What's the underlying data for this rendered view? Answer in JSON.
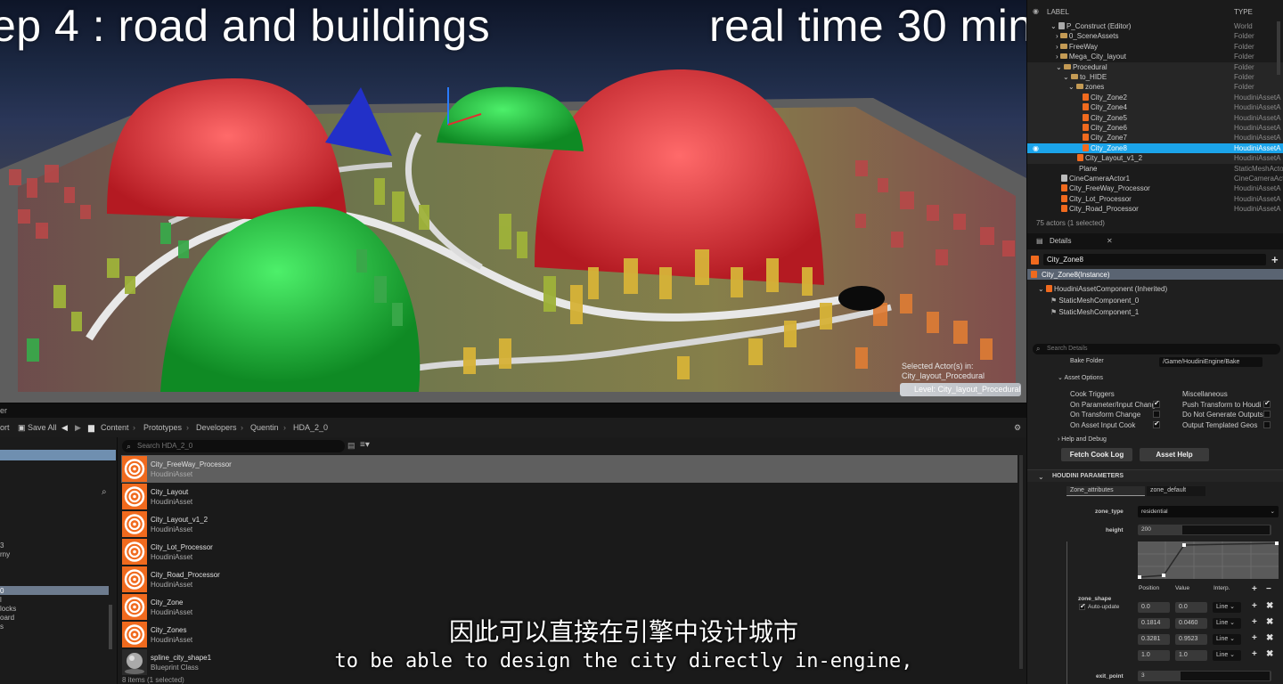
{
  "overlay": {
    "step_title": "ep 4 : road and buildings",
    "time_label": "real time 30 min"
  },
  "viewport": {
    "selected_actor_label": "Selected Actor(s) in:",
    "selected_level": "City_layout_Procedural",
    "level_pill": "Level: City_layout_Procedural"
  },
  "content_browser": {
    "tab_label": "er",
    "toolbar": {
      "import_label": "ort",
      "save_all": "Save All",
      "breadcrumbs": [
        "Content",
        "Prototypes",
        "Developers",
        "Quentin",
        "HDA_2_0"
      ]
    },
    "search_placeholder": "Search HDA_2_0",
    "left_folders": [
      "3",
      "rny",
      "0",
      "l",
      "locks",
      "oard",
      "s"
    ],
    "assets": [
      {
        "name": "City_FreeWay_Processor",
        "type": "HoudiniAsset"
      },
      {
        "name": "City_Layout",
        "type": "HoudiniAsset"
      },
      {
        "name": "City_Layout_v1_2",
        "type": "HoudiniAsset"
      },
      {
        "name": "City_Lot_Processor",
        "type": "HoudiniAsset"
      },
      {
        "name": "City_Road_Processor",
        "type": "HoudiniAsset"
      },
      {
        "name": "City_Zone",
        "type": "HoudiniAsset"
      },
      {
        "name": "City_Zones",
        "type": "HoudiniAsset"
      },
      {
        "name": "spline_city_shape1",
        "type": "Blueprint Class"
      }
    ],
    "status": "8 items (1 selected)"
  },
  "subtitles": {
    "chinese": "因此可以直接在引擎中设计城市",
    "english": "to be able to design the city directly in-engine,"
  },
  "outliner": {
    "col_label": "LABEL",
    "col_type": "TYPE",
    "rows": [
      {
        "label": "P_Construct (Editor)",
        "type": "World"
      },
      {
        "label": "0_SceneAssets",
        "type": "Folder"
      },
      {
        "label": "FreeWay",
        "type": "Folder"
      },
      {
        "label": "Mega_City_layout",
        "type": "Folder"
      },
      {
        "label": "Procedural",
        "type": "Folder"
      },
      {
        "label": "to_HIDE",
        "type": "Folder"
      },
      {
        "label": "zones",
        "type": "Folder"
      },
      {
        "label": "City_Zone2",
        "type": "HoudiniAssetA"
      },
      {
        "label": "City_Zone4",
        "type": "HoudiniAssetA"
      },
      {
        "label": "City_Zone5",
        "type": "HoudiniAssetA"
      },
      {
        "label": "City_Zone6",
        "type": "HoudiniAssetA"
      },
      {
        "label": "City_Zone7",
        "type": "HoudiniAssetA"
      },
      {
        "label": "City_Zone8",
        "type": "HoudiniAssetA"
      },
      {
        "label": "City_Layout_v1_2",
        "type": "HoudiniAssetA"
      },
      {
        "label": "Plane",
        "type": "StaticMeshActo"
      },
      {
        "label": "CineCameraActor1",
        "type": "CineCameraActo"
      },
      {
        "label": "City_FreeWay_Processor",
        "type": "HoudiniAssetA"
      },
      {
        "label": "City_Lot_Processor",
        "type": "HoudiniAssetA"
      },
      {
        "label": "City_Road_Processor",
        "type": "HoudiniAssetA"
      }
    ],
    "count": "75 actors (1 selected)"
  },
  "details": {
    "tab": "Details",
    "actor_name": "City_Zone8",
    "instance": "City_Zone8(Instance)",
    "components": [
      "HoudiniAssetComponent (Inherited)",
      "StaticMeshComponent_0",
      "StaticMeshComponent_1"
    ],
    "search_placeholder": "Search Details",
    "bake_folder_label": "Bake Folder",
    "bake_folder_value": "/Game/HoudiniEngine/Bake",
    "asset_options": "Asset Options",
    "cook_triggers": "Cook Triggers",
    "miscellaneous": "Miscellaneous",
    "opt_param_input": "On Parameter/Input Chang",
    "opt_transform": "On Transform Change",
    "opt_asset_input": "On Asset Input Cook",
    "opt_push_transform": "Push Transform to Houdi",
    "opt_no_gen_outputs": "Do Not Generate Outputs",
    "opt_templated": "Output Templated Geos",
    "help_debug": "Help and Debug",
    "fetch_cook_log": "Fetch Cook Log",
    "asset_help": "Asset Help",
    "houdini_params": "HOUDINI PARAMETERS",
    "tab_zone_attributes": "Zone_attributes",
    "tab_zone_default": "zone_default",
    "zone_type_label": "zone_type",
    "zone_type_value": "residential",
    "height_label": "height",
    "height_value": "200",
    "zone_shape_label": "zone_shape",
    "auto_update": "Auto-update",
    "ramp_col_position": "Position",
    "ramp_col_value": "Value",
    "ramp_col_interp": "Interp.",
    "ramp_points": [
      {
        "pos": "0.0",
        "val": "0.0",
        "interp": "Line"
      },
      {
        "pos": "0.1814",
        "val": "0.0460",
        "interp": "Line"
      },
      {
        "pos": "0.3281",
        "val": "0.9523",
        "interp": "Line"
      },
      {
        "pos": "1.0",
        "val": "1.0",
        "interp": "Line"
      }
    ],
    "exit_point_label": "exit_point",
    "exit_point_value": "3"
  },
  "colors": {
    "selection_blue": "#1ba4ea",
    "houdini_orange": "#f06a1e",
    "asset_selected": "#5f5f5f"
  }
}
